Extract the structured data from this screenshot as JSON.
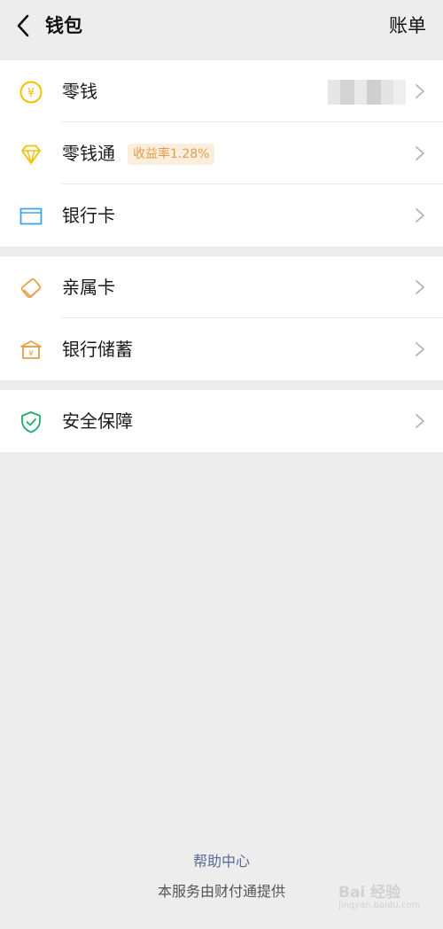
{
  "header": {
    "back_icon": "chevron-left-icon",
    "title": "钱包",
    "bill_label": "账单"
  },
  "groups": [
    {
      "items": [
        {
          "label": "零钱",
          "icon": "yuan-coin-icon",
          "icon_color": "#f2c200",
          "balance_blurred": true
        },
        {
          "label": "零钱通",
          "icon": "diamond-icon",
          "icon_color": "#f2c200",
          "badge": "收益率1.28%"
        },
        {
          "label": "银行卡",
          "icon": "bank-card-icon",
          "icon_color": "#3fa5e0"
        }
      ]
    },
    {
      "items": [
        {
          "label": "亲属卡",
          "icon": "family-card-icon",
          "icon_color": "#e8a04a"
        },
        {
          "label": "银行储蓄",
          "icon": "bank-building-icon",
          "icon_color": "#e8a04a"
        }
      ]
    },
    {
      "items": [
        {
          "label": "安全保障",
          "icon": "shield-check-icon",
          "icon_color": "#1aad6b"
        }
      ]
    }
  ],
  "footer": {
    "help_label": "帮助中心",
    "note": "本服务由财付通提供"
  },
  "watermark": {
    "text": "Bai 经验",
    "url_text": "jingyan.baidu.com"
  },
  "colors": {
    "background": "#ededed",
    "link": "#576b95",
    "badge_bg": "#fbeedd",
    "badge_text": "#e09c4e"
  }
}
